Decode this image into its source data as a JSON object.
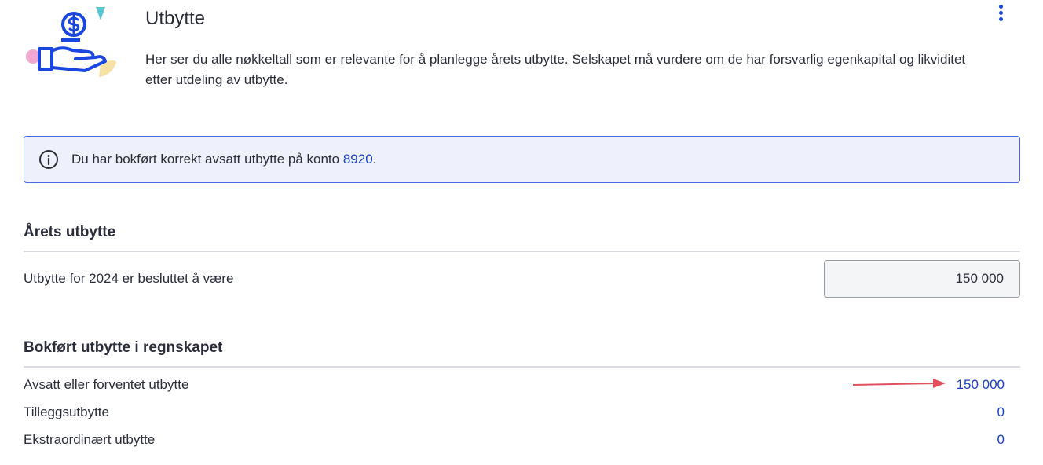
{
  "header": {
    "title": "Utbytte",
    "intro": "Her ser du alle nøkkeltall som er relevante for å planlegge årets utbytte. Selskapet må vurdere om de har forsvarlig egenkapital og likviditet etter utdeling av utbytte.",
    "menu_icon": "kebab-menu-icon"
  },
  "info": {
    "icon": "info-icon",
    "text": "Du har bokført korrekt avsatt utbytte på konto ",
    "account": "8920",
    "suffix": "."
  },
  "arets_utbytte": {
    "heading": "Årets utbytte",
    "label": "Utbytte for 2024 er besluttet å være",
    "value": "150 000"
  },
  "bokfort": {
    "heading": "Bokført utbytte i regnskapet",
    "rows": [
      {
        "label": "Avsatt eller forventet utbytte",
        "value": "150 000"
      },
      {
        "label": "Tilleggsutbytte",
        "value": "0"
      },
      {
        "label": "Ekstraordinært utbytte",
        "value": "0"
      }
    ]
  },
  "colors": {
    "accent": "#1a47e0",
    "link": "#1a3fc4",
    "info_bg": "#eef1fb",
    "annotation_arrow": "#e0505e"
  }
}
